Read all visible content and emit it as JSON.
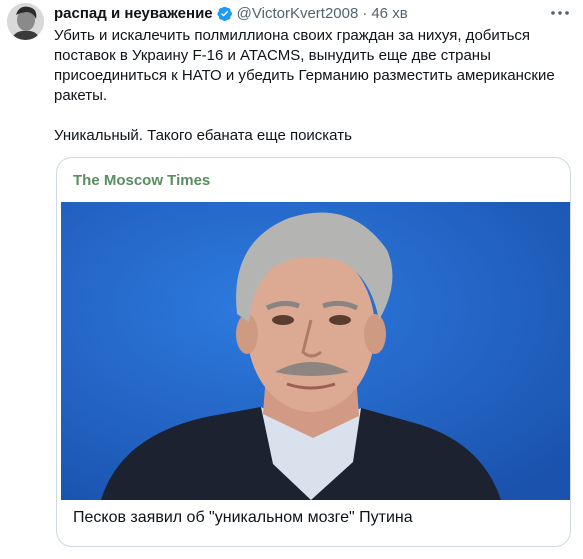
{
  "author": {
    "display_name": "распад и неуважение",
    "handle": "@VictorKvert2008",
    "separator": "·",
    "time": "46 хв"
  },
  "tweet": {
    "line1": "Убить и искалечить полмиллиона своих граждан за нихуя, добиться",
    "line2": "поставок в Украину F-16 и ATACMS, вынудить еще две страны",
    "line3": "присоединиться к НАТО и убедить Германию разместить американские",
    "line4": "ракеты.",
    "line5": "Уникальный. Такого ебаната еще поискать"
  },
  "card": {
    "source": "The Moscow Times",
    "title": "Песков заявил об \"уникальном мозге\" Путина"
  },
  "colors": {
    "source_green": "#5a8d62",
    "verified_blue": "#1d9bf0",
    "photo_background": "#1f5fbf"
  },
  "icons": [
    "verified-icon",
    "more-icon"
  ]
}
